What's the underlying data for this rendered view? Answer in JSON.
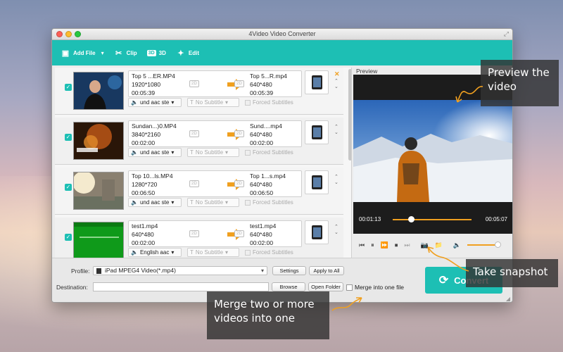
{
  "window": {
    "title": "4Video Video Converter"
  },
  "toolbar": {
    "add_file": "Add File",
    "clip": "Clip",
    "threed": "3D",
    "threed_badge": "3D",
    "edit": "Edit"
  },
  "items": [
    {
      "src_name": "Top 5 ...ER.MP4",
      "src_res": "1920*1080",
      "src_dur": "00:05:39",
      "dst_name": "Top 5...R.mp4",
      "dst_res": "640*480",
      "dst_dur": "00:05:39",
      "audio": "und aac ste",
      "subtitle": "No Subtitle",
      "forced": "Forced Subtitles",
      "badge": "2D"
    },
    {
      "src_name": "Sundan...)0.MP4",
      "src_res": "3840*2160",
      "src_dur": "00:02:00",
      "dst_name": "Sund....mp4",
      "dst_res": "640*480",
      "dst_dur": "00:02:00",
      "audio": "und aac ste",
      "subtitle": "No Subtitle",
      "forced": "Forced Subtitles",
      "badge": "2D"
    },
    {
      "src_name": "Top 10...ls.MP4",
      "src_res": "1280*720",
      "src_dur": "00:06:50",
      "dst_name": "Top 1...s.mp4",
      "dst_res": "640*480",
      "dst_dur": "00:06:50",
      "audio": "und aac ste",
      "subtitle": "No Subtitle",
      "forced": "Forced Subtitles",
      "badge": "2D"
    },
    {
      "src_name": "test1.mp4",
      "src_res": "640*480",
      "src_dur": "00:02:00",
      "dst_name": "test1.mp4",
      "dst_res": "640*480",
      "dst_dur": "00:02:00",
      "audio": "English aac",
      "subtitle": "No Subtitle",
      "forced": "Forced Subtitles",
      "badge": "2D"
    }
  ],
  "preview": {
    "label": "Preview",
    "time_current": "00:01:13",
    "time_total": "00:05:07",
    "progress": 0.24
  },
  "bottom": {
    "profile_label": "Profile:",
    "profile_value": "iPad MPEG4 Video(*.mp4)",
    "settings": "Settings",
    "apply_all": "Apply to All",
    "destination_label": "Destination:",
    "destination_value": "",
    "browse": "Browse",
    "open_folder": "Open Folder",
    "merge": "Merge into one file",
    "convert": "Convert"
  },
  "callouts": {
    "preview": "Preview the video",
    "snapshot": "Take snapshot",
    "merge": "Merge two or more videos into one"
  },
  "colors": {
    "accent": "#1dbfb4",
    "arrow": "#f0a020"
  }
}
